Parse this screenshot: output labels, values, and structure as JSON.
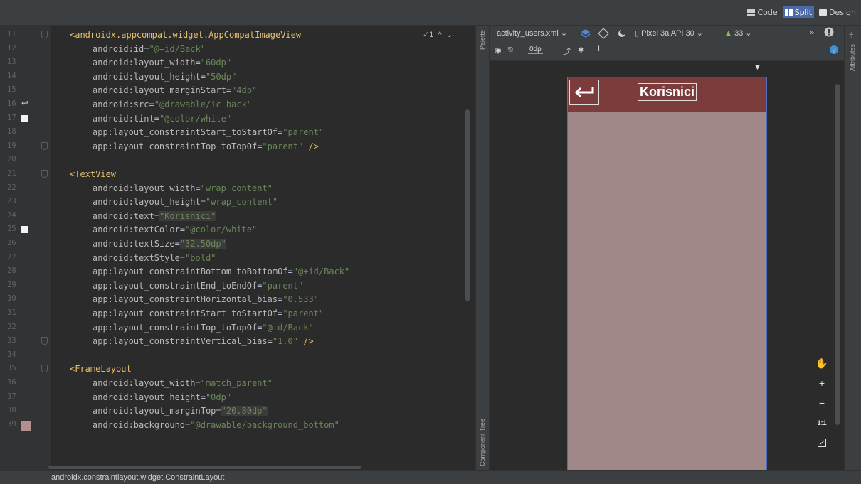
{
  "view_modes": {
    "code": "Code",
    "split": "Split",
    "design": "Design",
    "active": "Split"
  },
  "editor": {
    "warning_count": "1",
    "lines": [
      {
        "n": "11",
        "indent": 1,
        "parts": [
          [
            "tag",
            "<androidx.appcompat.widget.AppCompatImageView"
          ]
        ]
      },
      {
        "n": "12",
        "indent": 2,
        "parts": [
          [
            "attr",
            "android:id"
          ],
          [
            "eq",
            "="
          ],
          [
            "val",
            "\"@+id/Back\""
          ]
        ]
      },
      {
        "n": "13",
        "indent": 2,
        "parts": [
          [
            "attr",
            "android:layout_width"
          ],
          [
            "eq",
            "="
          ],
          [
            "val",
            "\"60dp\""
          ]
        ]
      },
      {
        "n": "14",
        "indent": 2,
        "parts": [
          [
            "attr",
            "android:layout_height"
          ],
          [
            "eq",
            "="
          ],
          [
            "val",
            "\"50dp\""
          ]
        ]
      },
      {
        "n": "15",
        "indent": 2,
        "parts": [
          [
            "attr",
            "android:layout_marginStart"
          ],
          [
            "eq",
            "="
          ],
          [
            "val",
            "\"4dp\""
          ]
        ]
      },
      {
        "n": "16",
        "indent": 2,
        "parts": [
          [
            "attr",
            "android:src"
          ],
          [
            "eq",
            "="
          ],
          [
            "val",
            "\"@drawable/ic_back\""
          ]
        ]
      },
      {
        "n": "17",
        "indent": 2,
        "parts": [
          [
            "attr",
            "android:tint"
          ],
          [
            "eq",
            "="
          ],
          [
            "val",
            "\"@color/white\""
          ]
        ]
      },
      {
        "n": "18",
        "indent": 2,
        "parts": [
          [
            "attr",
            "app:layout_constraintStart_toStartOf"
          ],
          [
            "eq",
            "="
          ],
          [
            "val",
            "\"parent\""
          ]
        ]
      },
      {
        "n": "19",
        "indent": 2,
        "parts": [
          [
            "attr",
            "app:layout_constraintTop_toTopOf"
          ],
          [
            "eq",
            "="
          ],
          [
            "val",
            "\"parent\""
          ],
          [
            "tag",
            " />"
          ]
        ]
      },
      {
        "n": "20",
        "indent": 1,
        "parts": []
      },
      {
        "n": "21",
        "indent": 1,
        "parts": [
          [
            "tag",
            "<TextView"
          ]
        ]
      },
      {
        "n": "22",
        "indent": 2,
        "parts": [
          [
            "attr",
            "android:layout_width"
          ],
          [
            "eq",
            "="
          ],
          [
            "val",
            "\"wrap_content\""
          ]
        ]
      },
      {
        "n": "23",
        "indent": 2,
        "parts": [
          [
            "attr",
            "android:layout_height"
          ],
          [
            "eq",
            "="
          ],
          [
            "val",
            "\"wrap_content\""
          ]
        ]
      },
      {
        "n": "24",
        "indent": 2,
        "parts": [
          [
            "attr",
            "android:text"
          ],
          [
            "eq",
            "="
          ],
          [
            "val",
            "\"Korisnici\""
          ]
        ]
      },
      {
        "n": "25",
        "indent": 2,
        "parts": [
          [
            "attr",
            "android:textColor"
          ],
          [
            "eq",
            "="
          ],
          [
            "val",
            "\"@color/white\""
          ]
        ]
      },
      {
        "n": "26",
        "indent": 2,
        "parts": [
          [
            "attr",
            "android:textSize"
          ],
          [
            "eq",
            "="
          ],
          [
            "val",
            "\"32.50dp\""
          ]
        ]
      },
      {
        "n": "27",
        "indent": 2,
        "parts": [
          [
            "attr",
            "android:textStyle"
          ],
          [
            "eq",
            "="
          ],
          [
            "val",
            "\"bold\""
          ]
        ]
      },
      {
        "n": "28",
        "indent": 2,
        "parts": [
          [
            "attr",
            "app:layout_constraintBottom_toBottomOf"
          ],
          [
            "eq",
            "="
          ],
          [
            "val",
            "\"@+id/Back\""
          ]
        ]
      },
      {
        "n": "29",
        "indent": 2,
        "parts": [
          [
            "attr",
            "app:layout_constraintEnd_toEndOf"
          ],
          [
            "eq",
            "="
          ],
          [
            "val",
            "\"parent\""
          ]
        ]
      },
      {
        "n": "30",
        "indent": 2,
        "parts": [
          [
            "attr",
            "app:layout_constraintHorizontal_bias"
          ],
          [
            "eq",
            "="
          ],
          [
            "val",
            "\"0.533\""
          ]
        ]
      },
      {
        "n": "31",
        "indent": 2,
        "parts": [
          [
            "attr",
            "app:layout_constraintStart_toStartOf"
          ],
          [
            "eq",
            "="
          ],
          [
            "val",
            "\"parent\""
          ]
        ]
      },
      {
        "n": "32",
        "indent": 2,
        "parts": [
          [
            "attr",
            "app:layout_constraintTop_toTopOf"
          ],
          [
            "eq",
            "="
          ],
          [
            "val",
            "\"@id/Back\""
          ]
        ]
      },
      {
        "n": "33",
        "indent": 2,
        "parts": [
          [
            "attr",
            "app:layout_constraintVertical_bias"
          ],
          [
            "eq",
            "="
          ],
          [
            "val",
            "\"1.0\""
          ],
          [
            "tag",
            " />"
          ]
        ]
      },
      {
        "n": "34",
        "indent": 1,
        "parts": []
      },
      {
        "n": "35",
        "indent": 1,
        "parts": [
          [
            "tag",
            "<FrameLayout"
          ]
        ]
      },
      {
        "n": "36",
        "indent": 2,
        "parts": [
          [
            "attr",
            "android:layout_width"
          ],
          [
            "eq",
            "="
          ],
          [
            "val",
            "\"match_parent\""
          ]
        ]
      },
      {
        "n": "37",
        "indent": 2,
        "parts": [
          [
            "attr",
            "android:layout_height"
          ],
          [
            "eq",
            "="
          ],
          [
            "val",
            "\"0dp\""
          ]
        ]
      },
      {
        "n": "38",
        "indent": 2,
        "parts": [
          [
            "attr",
            "android:layout_marginTop"
          ],
          [
            "eq",
            "="
          ],
          [
            "val",
            "\"20.80dp\""
          ]
        ]
      },
      {
        "n": "39",
        "indent": 2,
        "parts": [
          [
            "attr",
            "android:background"
          ],
          [
            "eq",
            "="
          ],
          [
            "val",
            "\"@drawable/background_bottom\""
          ]
        ]
      }
    ]
  },
  "strips": {
    "palette": "Palette",
    "component_tree": "Component Tree",
    "attributes": "Attributes"
  },
  "design": {
    "file_name": "activity_users.xml",
    "device": "Pixel 3a API 30",
    "api_level": "33",
    "margin": "0dp",
    "preview_title": "Korisnici",
    "zoom_reset": "1:1",
    "colors": {
      "app_bar": "#7d3c3c",
      "screen_bg": "#a08888"
    }
  },
  "status": {
    "breadcrumb": "androidx.constraintlayout.widget.ConstraintLayout"
  }
}
